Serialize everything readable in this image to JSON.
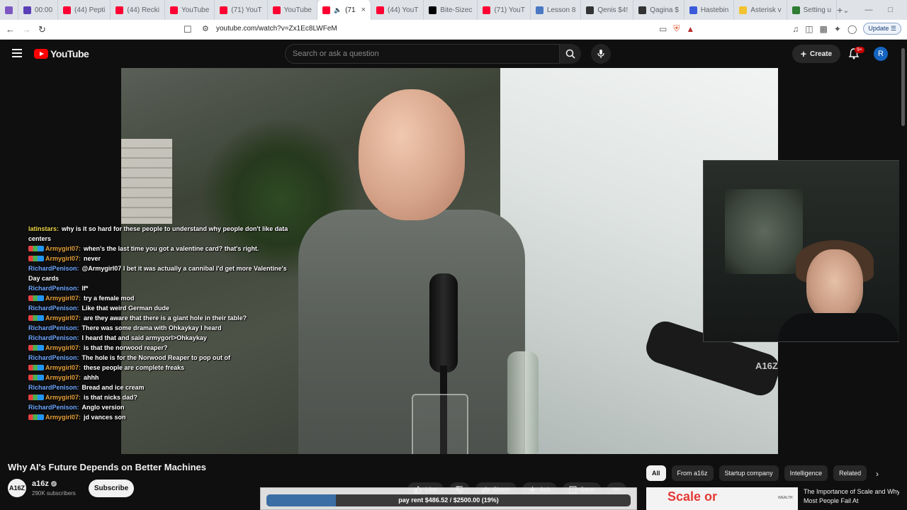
{
  "browser": {
    "tabs": [
      {
        "label": "00:00",
        "color": "#5b3fb6",
        "active": false
      },
      {
        "label": "(44) Pepti",
        "color": "#ff0033",
        "active": false
      },
      {
        "label": "(44) Recki",
        "color": "#ff0033",
        "active": false
      },
      {
        "label": "YouTube",
        "color": "#ff0033",
        "active": false
      },
      {
        "label": "(71) YouT",
        "color": "#ff0033",
        "active": false
      },
      {
        "label": "YouTube",
        "color": "#ff0033",
        "active": false
      },
      {
        "label": "(71",
        "color": "#ff0033",
        "active": true
      },
      {
        "label": "(44) YouT",
        "color": "#ff0033",
        "active": false
      },
      {
        "label": "Bite-Sizec",
        "color": "#000000",
        "active": false
      },
      {
        "label": "(71) YouT",
        "color": "#ff0033",
        "active": false
      },
      {
        "label": "Lesson 8",
        "color": "#4a78c2",
        "active": false
      },
      {
        "label": "Qenis $4!",
        "color": "#333333",
        "active": false
      },
      {
        "label": "Qagina $",
        "color": "#333333",
        "active": false
      },
      {
        "label": "Hastebin",
        "color": "#3b5bdb",
        "active": false
      },
      {
        "label": "Asterisk v",
        "color": "#f2c230",
        "active": false
      },
      {
        "label": "Setting u",
        "color": "#2e7d32",
        "active": false
      }
    ],
    "new_tab_glyph": "+",
    "url": "youtube.com/watch?v=Zx1Ec8LWFeM",
    "update_label": "Update"
  },
  "header": {
    "logo_text": "YouTube",
    "search_placeholder": "Search or ask a question",
    "create_label": "Create",
    "notifications_badge": "9+",
    "avatar_letter": "R"
  },
  "video": {
    "watermark": "A16Z"
  },
  "chat": [
    {
      "user": "latinstars:",
      "color": "#f0d84a",
      "badges": false,
      "text": "why is it so hard for these people to understand why people don't like data centers"
    },
    {
      "user": "Armygirl07:",
      "color": "#e8a33d",
      "badges": true,
      "text": "when's the last time you got a valentine card? that's right."
    },
    {
      "user": "Armygirl07:",
      "color": "#e8a33d",
      "badges": true,
      "text": "never"
    },
    {
      "user": "RichardPenison:",
      "color": "#6fa8ff",
      "badges": false,
      "text": "@Armygirl07 I bet it was actually a cannibal I'd get more Valentine's Day cards"
    },
    {
      "user": "RichardPenison:",
      "color": "#6fa8ff",
      "badges": false,
      "text": "If*"
    },
    {
      "user": "Armygirl07:",
      "color": "#e8a33d",
      "badges": true,
      "text": "try a female mod"
    },
    {
      "user": "RichardPenison:",
      "color": "#6fa8ff",
      "badges": false,
      "text": "Like that weird German dude"
    },
    {
      "user": "Armygirl07:",
      "color": "#e8a33d",
      "badges": true,
      "text": "are they aware that there is a giant hole in their table?"
    },
    {
      "user": "RichardPenison:",
      "color": "#6fa8ff",
      "badges": false,
      "text": "There was some drama with Ohkaykay I heard"
    },
    {
      "user": "RichardPenison:",
      "color": "#6fa8ff",
      "badges": false,
      "text": "I heard that and said armygorl>Ohkaykay"
    },
    {
      "user": "Armygirl07:",
      "color": "#e8a33d",
      "badges": true,
      "text": "is that the norwood reaper?"
    },
    {
      "user": "RichardPenison:",
      "color": "#6fa8ff",
      "badges": false,
      "text": "The hole is for the Norwood Reaper to pop out of"
    },
    {
      "user": "Armygirl07:",
      "color": "#e8a33d",
      "badges": true,
      "text": "these people are complete freaks"
    },
    {
      "user": "Armygirl07:",
      "color": "#e8a33d",
      "badges": true,
      "text": "ahhh"
    },
    {
      "user": "RichardPenison:",
      "color": "#6fa8ff",
      "badges": false,
      "text": "Bread and ice cream"
    },
    {
      "user": "Armygirl07:",
      "color": "#e8a33d",
      "badges": true,
      "text": "is that nicks dad?"
    },
    {
      "user": "RichardPenison:",
      "color": "#6fa8ff",
      "badges": false,
      "text": "Anglo version"
    },
    {
      "user": "Armygirl07:",
      "color": "#e8a33d",
      "badges": true,
      "text": "jd vances son"
    }
  ],
  "details": {
    "title": "Why AI's Future Depends on Better Machines",
    "channel_avatar_text": "A16Z",
    "channel_name": "a16z",
    "subscribers": "290K subscribers",
    "subscribe_label": "Subscribe",
    "actions": [
      {
        "icon": "like-icon",
        "label": "Like"
      },
      {
        "icon": "dislike-icon",
        "label": ""
      },
      {
        "icon": "share-icon",
        "label": "Share"
      },
      {
        "icon": "sparkle-icon",
        "label": "Ask"
      },
      {
        "icon": "save-icon",
        "label": "Save"
      },
      {
        "icon": "more-icon",
        "label": "•••"
      }
    ]
  },
  "progress": {
    "label": "pay rent $486.52 / $2500.00 (19%)",
    "fraction": 0.19,
    "fill_color": "#3a6ea5"
  },
  "sidebar": {
    "chips": [
      {
        "label": "All",
        "active": true
      },
      {
        "label": "From a16z",
        "active": false
      },
      {
        "label": "Startup company",
        "active": false
      },
      {
        "label": "Intelligence",
        "active": false
      },
      {
        "label": "Related",
        "active": false
      }
    ],
    "recommended": {
      "thumb_text": "Scale or",
      "thumb_tag": "WEALTH",
      "title": "The Importance of Scale and Why Most People Fail At"
    }
  }
}
